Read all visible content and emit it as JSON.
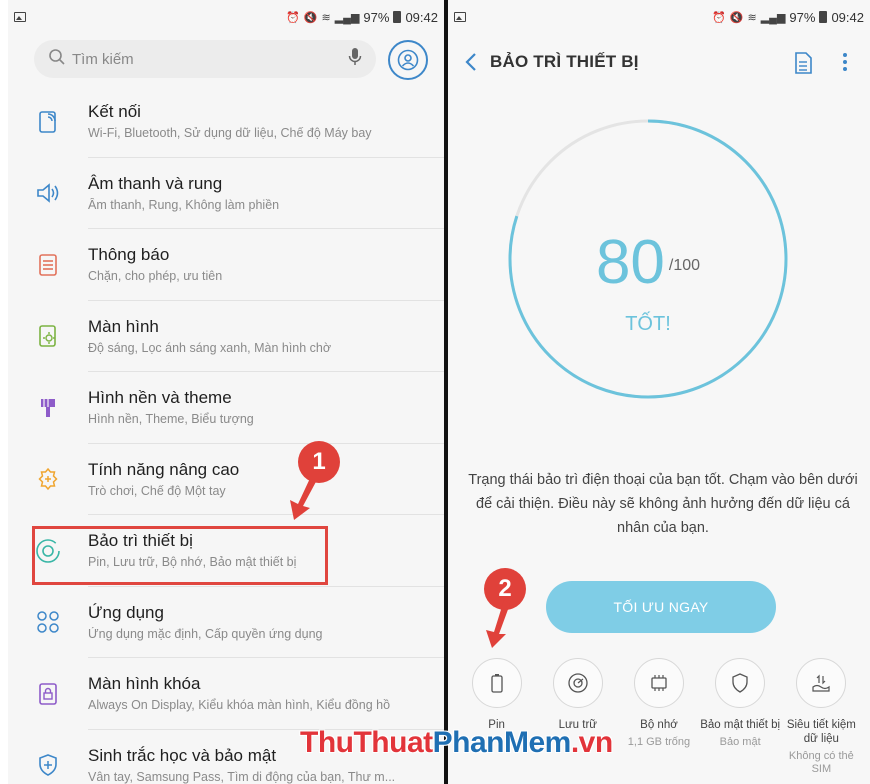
{
  "status": {
    "battery": "97%",
    "time_left": "09:42",
    "time_right": "09:42"
  },
  "left": {
    "search_placeholder": "Tìm kiếm",
    "items": [
      {
        "title": "Kết nối",
        "subtitle": "Wi-Fi, Bluetooth, Sử dụng dữ liệu, Chế độ Máy bay",
        "icon": "wifi-icon"
      },
      {
        "title": "Âm thanh và rung",
        "subtitle": "Âm thanh, Rung, Không làm phiền",
        "icon": "speaker-icon"
      },
      {
        "title": "Thông báo",
        "subtitle": "Chặn, cho phép, ưu tiên",
        "icon": "notification-icon"
      },
      {
        "title": "Màn hình",
        "subtitle": "Độ sáng, Lọc ánh sáng xanh, Màn hình chờ",
        "icon": "display-icon"
      },
      {
        "title": "Hình nền và theme",
        "subtitle": "Hình nền, Theme, Biểu tượng",
        "icon": "brush-icon"
      },
      {
        "title": "Tính năng nâng cao",
        "subtitle": "Trò chơi, Chế độ Một tay",
        "icon": "advanced-gear-icon"
      },
      {
        "title": "Bảo trì thiết bị",
        "subtitle": "Pin, Lưu trữ, Bộ nhớ, Bảo mật thiết bị",
        "icon": "device-care-icon"
      },
      {
        "title": "Ứng dụng",
        "subtitle": "Ứng dụng mặc định, Cấp quyền ứng dụng",
        "icon": "apps-grid-icon"
      },
      {
        "title": "Màn hình khóa",
        "subtitle": "Always On Display, Kiểu khóa màn hình, Kiểu đồng hồ",
        "icon": "lock-icon"
      },
      {
        "title": "Sinh trắc học và bảo mật",
        "subtitle": "Vân tay, Samsung Pass, Tìm di động của bạn, Thư m...",
        "icon": "shield-plus-icon"
      }
    ]
  },
  "right": {
    "title": "BẢO TRÌ THIẾT BỊ",
    "score": "80",
    "score_max": "/100",
    "score_label": "TỐT!",
    "description": "Trạng thái bảo trì điện thoại của bạn tốt. Chạm vào bên dưới để cải thiện. Điều này sẽ không ảnh hưởng đến dữ liệu cá nhân của bạn.",
    "optimize_label": "TỐI ƯU NGAY",
    "tools": [
      {
        "label": "Pin",
        "sub": "",
        "icon": "battery-icon"
      },
      {
        "label": "Lưu trữ",
        "sub": "",
        "icon": "storage-icon"
      },
      {
        "label": "Bộ nhớ",
        "sub": "1,1 GB trống",
        "icon": "memory-chip-icon"
      },
      {
        "label": "Bảo mật thiết bị",
        "sub": "Bảo mật",
        "icon": "shield-icon"
      },
      {
        "label": "Siêu tiết kiệm dữ liệu",
        "sub": "Không có thẻ SIM",
        "icon": "data-saver-icon"
      }
    ]
  },
  "annotations": {
    "step1": "1",
    "step2": "2"
  },
  "watermark": {
    "part1": "ThuThuat",
    "part2": "PhanMem",
    "part3": ".vn"
  },
  "colors": {
    "accent": "#3d87c9",
    "score": "#6cc3dc",
    "button": "#7fcde6",
    "marker": "#e0413a"
  }
}
